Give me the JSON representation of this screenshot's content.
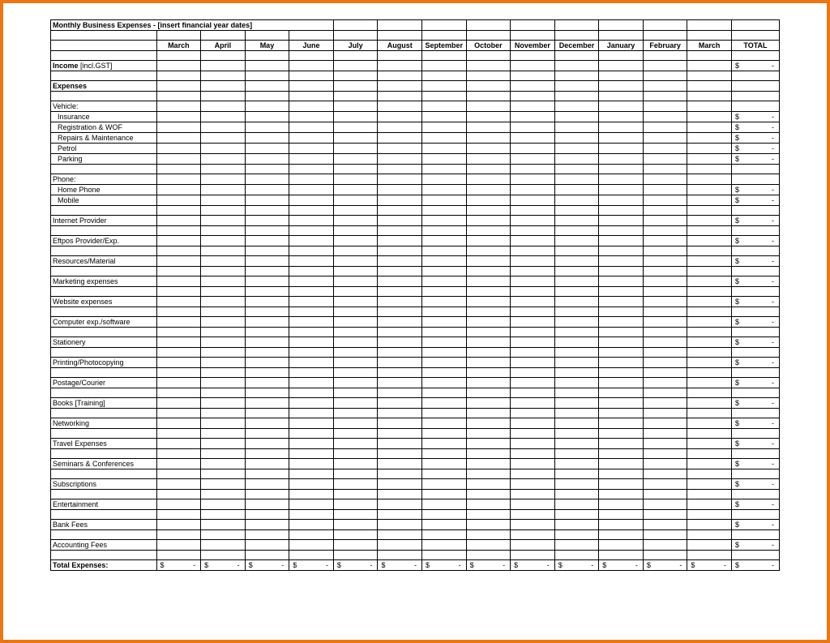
{
  "title": "Monthly Business Expenses - [insert financial year dates]",
  "months": [
    "March",
    "April",
    "May",
    "June",
    "July",
    "August",
    "September",
    "October",
    "November",
    "December",
    "January",
    "February",
    "March"
  ],
  "total_label": "TOTAL",
  "income_label": "Income",
  "income_suffix": " [incl.GST]",
  "expenses_label": "Expenses",
  "total_expenses_label": "Total Expenses:",
  "currency": "$",
  "dash": "-",
  "rows": [
    {
      "type": "header",
      "label": "Vehicle:"
    },
    {
      "type": "sub",
      "label": "Insurance",
      "total": true
    },
    {
      "type": "sub",
      "label": "Registration & WOF",
      "total": true
    },
    {
      "type": "sub",
      "label": "Repairs & Maintenance",
      "total": true
    },
    {
      "type": "sub",
      "label": "Petrol",
      "total": true
    },
    {
      "type": "sub",
      "label": "Parking",
      "total": true
    },
    {
      "type": "blank"
    },
    {
      "type": "header",
      "label": "Phone:"
    },
    {
      "type": "sub",
      "label": "Home Phone",
      "total": true
    },
    {
      "type": "sub",
      "label": "Mobile",
      "total": true
    },
    {
      "type": "blank"
    },
    {
      "type": "item",
      "label": "Internet Provider",
      "total": true
    },
    {
      "type": "blank"
    },
    {
      "type": "item",
      "label": "Eftpos Provider/Exp.",
      "total": true
    },
    {
      "type": "blank"
    },
    {
      "type": "item",
      "label": "Resources/Material",
      "total": true
    },
    {
      "type": "blank"
    },
    {
      "type": "item",
      "label": "Marketing expenses",
      "total": true
    },
    {
      "type": "blank"
    },
    {
      "type": "item",
      "label": "Website expenses",
      "total": true
    },
    {
      "type": "blank"
    },
    {
      "type": "item",
      "label": "Computer exp./software",
      "total": true
    },
    {
      "type": "blank"
    },
    {
      "type": "item",
      "label": "Stationery",
      "total": true
    },
    {
      "type": "blank"
    },
    {
      "type": "item",
      "label": "Printing/Photocopying",
      "total": true
    },
    {
      "type": "blank"
    },
    {
      "type": "item",
      "label": "Postage/Courier",
      "total": true
    },
    {
      "type": "blank"
    },
    {
      "type": "item",
      "label": "Books [Training]",
      "total": true
    },
    {
      "type": "blank"
    },
    {
      "type": "item",
      "label": "Networking",
      "total": true
    },
    {
      "type": "blank"
    },
    {
      "type": "item",
      "label": "Travel Expenses",
      "total": true
    },
    {
      "type": "blank"
    },
    {
      "type": "item",
      "label": "Seminars & Conferences",
      "total": true
    },
    {
      "type": "blank"
    },
    {
      "type": "item",
      "label": "Subscriptions",
      "total": true
    },
    {
      "type": "blank"
    },
    {
      "type": "item",
      "label": "Entertainment",
      "total": true
    },
    {
      "type": "blank"
    },
    {
      "type": "item",
      "label": "Bank Fees",
      "total": true
    },
    {
      "type": "blank"
    },
    {
      "type": "item",
      "label": "Accounting Fees",
      "total": true
    },
    {
      "type": "blank"
    }
  ]
}
